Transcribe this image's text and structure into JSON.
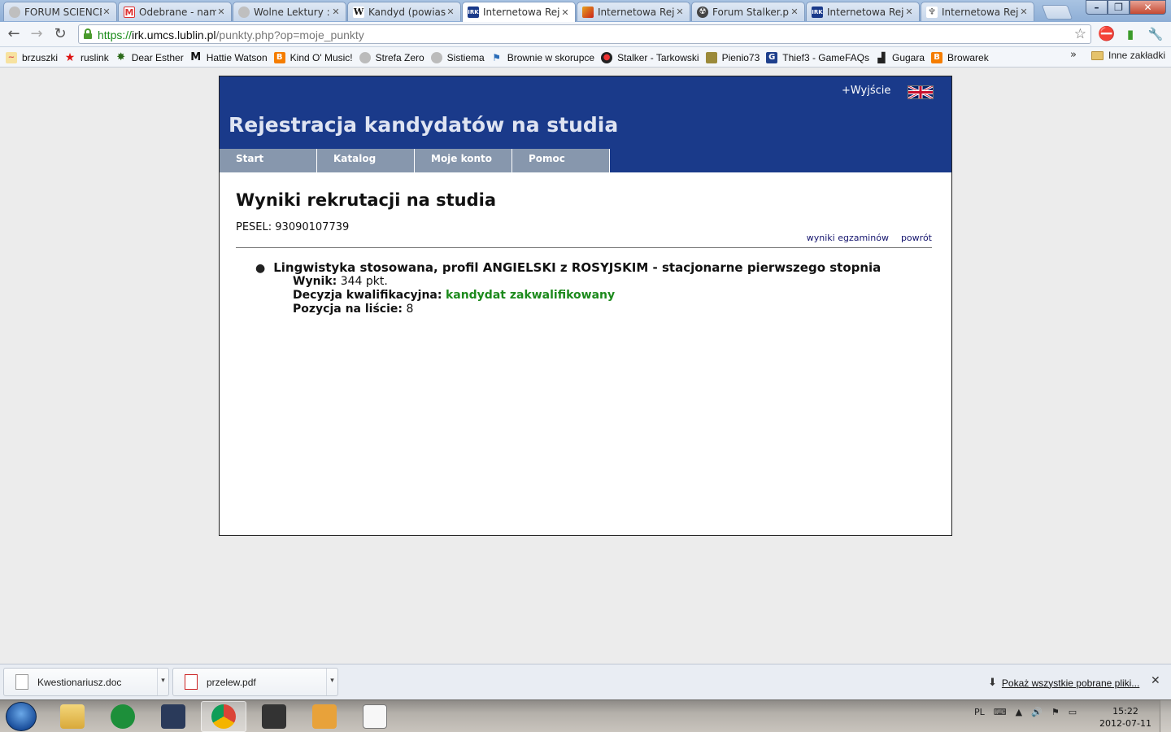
{
  "browser": {
    "tabs": [
      {
        "title": "FORUM SCIENCE",
        "icon": "globe-icon"
      },
      {
        "title": "Odebrane - nama",
        "icon": "gmail-icon"
      },
      {
        "title": "Wolne Lektury :: \\",
        "icon": "globe-icon"
      },
      {
        "title": "Kandyd (powiastk",
        "icon": "wikipedia-icon"
      },
      {
        "title": "Internetowa Reje:",
        "icon": "usos-icon"
      },
      {
        "title": "Internetowa Reje:",
        "icon": "university-icon"
      },
      {
        "title": "Forum Stalker.pl ·",
        "icon": "radiation-icon"
      },
      {
        "title": "Internetowa Reje:",
        "icon": "usos-icon"
      },
      {
        "title": "Internetowa Reje:",
        "icon": "eagle-icon"
      }
    ],
    "address": {
      "protocol": "https://",
      "host": "irk.umcs.lublin.pl",
      "path": "/punkty.php?op=moje_punkty"
    },
    "bookmarks": [
      {
        "label": "brzuszki",
        "icon": "chart-icon"
      },
      {
        "label": "ruslink",
        "icon": "red-star-icon"
      },
      {
        "label": "Dear Esther",
        "icon": "leaf-icon"
      },
      {
        "label": "Hattie Watson",
        "icon": "m-logo-icon"
      },
      {
        "label": "Kind O' Music!",
        "icon": "blogger-icon"
      },
      {
        "label": "Strefa Zero",
        "icon": "globe-icon"
      },
      {
        "label": "Sistiema",
        "icon": "globe-icon"
      },
      {
        "label": "Brownie w skorupce",
        "icon": "pin-icon"
      },
      {
        "label": "Stalker - Tarkowski",
        "icon": "film-reel-icon"
      },
      {
        "label": "Pienio73",
        "icon": "photo-icon"
      },
      {
        "label": "Thief3 - GameFAQs",
        "icon": "gamefaqs-icon"
      },
      {
        "label": "Gugara",
        "icon": "boot-icon"
      },
      {
        "label": "Browarek",
        "icon": "blogger-icon"
      }
    ],
    "bookmarks_more": "»",
    "other_bookmarks": "Inne zakładki"
  },
  "page": {
    "logout": "+Wyjście",
    "site_title": "Rejestracja kandydatów na studia",
    "menu": [
      "Start",
      "Katalog",
      "Moje konto",
      "Pomoc"
    ],
    "heading": "Wyniki rekrutacji na studia",
    "pesel": "PESEL: 93090107739",
    "links": [
      "wyniki egzaminów",
      "powrót"
    ],
    "result": {
      "programme": "Lingwistyka stosowana, profil ANGIELSKI z ROSYJSKIM - stacjonarne pierwszego stopnia",
      "score_label": "Wynik:",
      "score_value": "344 pkt.",
      "decision_label": "Decyzja kwalifikacyjna:",
      "decision_value": "kandydat zakwalifikowany",
      "position_label": "Pozycja na liście:",
      "position_value": "8"
    }
  },
  "downloads": {
    "items": [
      {
        "name": "Kwestionariusz.doc",
        "icon": "document-icon"
      },
      {
        "name": "przelew.pdf",
        "icon": "pdf-icon"
      }
    ],
    "show_all": "Pokaż wszystkie pobrane pliki..."
  },
  "taskbar": {
    "apps": [
      "explorer-icon",
      "utorrent-icon",
      "media-player-icon",
      "chrome-icon",
      "foobar-icon",
      "notepad-icon",
      "odf-document-icon"
    ],
    "language": "PL",
    "time": "15:22",
    "date": "2012-07-11"
  },
  "colors": {
    "irk_header": "#1a3a8a",
    "irk_menu": "#8797ad",
    "qualified_green": "#1c8a1c"
  }
}
